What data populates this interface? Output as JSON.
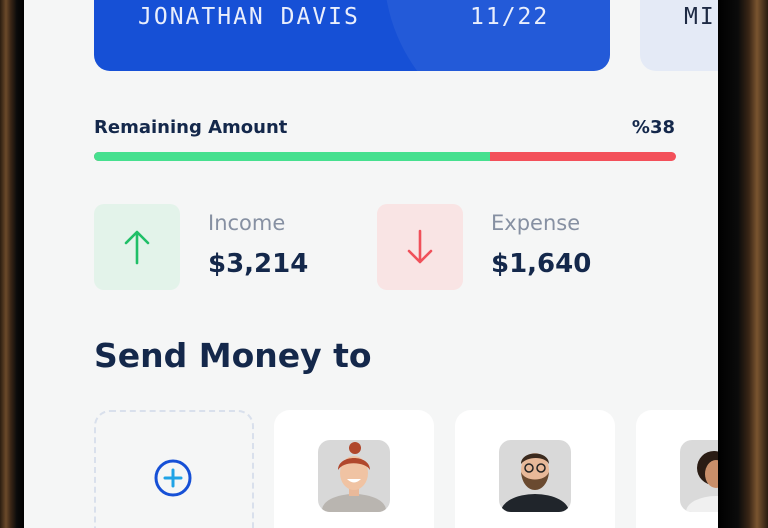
{
  "card": {
    "holder": "JONATHAN DAVIS",
    "expiry": "11/22",
    "next_card_holder_partial": "MI"
  },
  "remaining": {
    "label": "Remaining Amount",
    "value": "%38",
    "fill_fraction": 0.68
  },
  "income": {
    "label": "Income",
    "amount": "$3,214",
    "icon": "arrow-up-icon",
    "color": "#1fbf67"
  },
  "expense": {
    "label": "Expense",
    "amount": "$1,640",
    "icon": "arrow-down-icon",
    "color": "#f0505a"
  },
  "send": {
    "title": "Send Money to",
    "add_icon": "plus-circle-icon",
    "contacts": [
      {
        "avatar": "avatar-woman-red-hair"
      },
      {
        "avatar": "avatar-man-beard"
      },
      {
        "avatar": "avatar-woman-curly-hair"
      }
    ]
  },
  "colors": {
    "accent": "#1650d6",
    "text_dark": "#14284b",
    "muted": "#8690a2"
  }
}
